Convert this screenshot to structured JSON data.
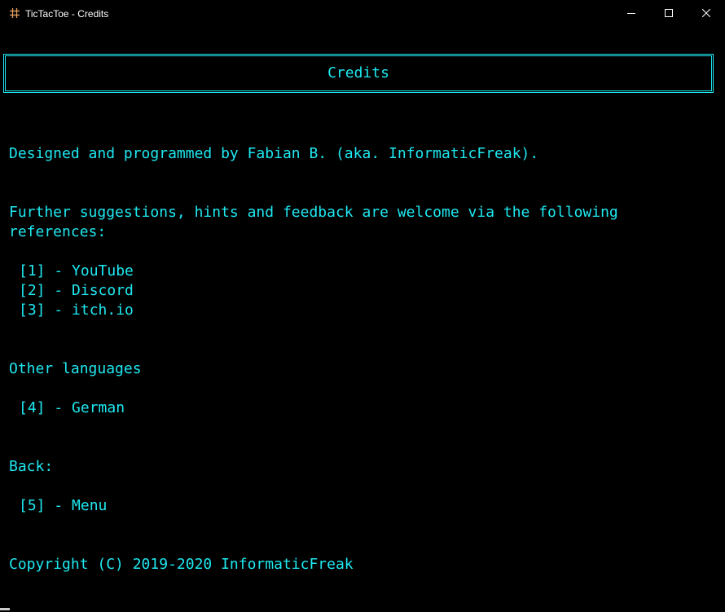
{
  "window": {
    "title": "TicTacToe - Credits",
    "app_icon": "hash-icon",
    "controls": [
      "minimize-icon",
      "maximize-icon",
      "close-icon"
    ]
  },
  "colors": {
    "text": "#1ee8f0",
    "background": "#000000"
  },
  "header": {
    "title": "Credits"
  },
  "credits": {
    "designed_by": "Designed and programmed by Fabian B. (aka. InformaticFreak).",
    "suggestions_line1": "Further suggestions, hints and feedback are welcome via the following",
    "suggestions_line2": "references:"
  },
  "references": [
    {
      "label": "[1] - YouTube"
    },
    {
      "label": "[2] - Discord"
    },
    {
      "label": "[3] - itch.io"
    }
  ],
  "languages": {
    "heading": "Other languages",
    "options": [
      {
        "label": "[4] - German"
      }
    ]
  },
  "back": {
    "heading": "Back:",
    "options": [
      {
        "label": "[5] - Menu"
      }
    ]
  },
  "copyright": "Copyright (C) 2019-2020 InformaticFreak"
}
